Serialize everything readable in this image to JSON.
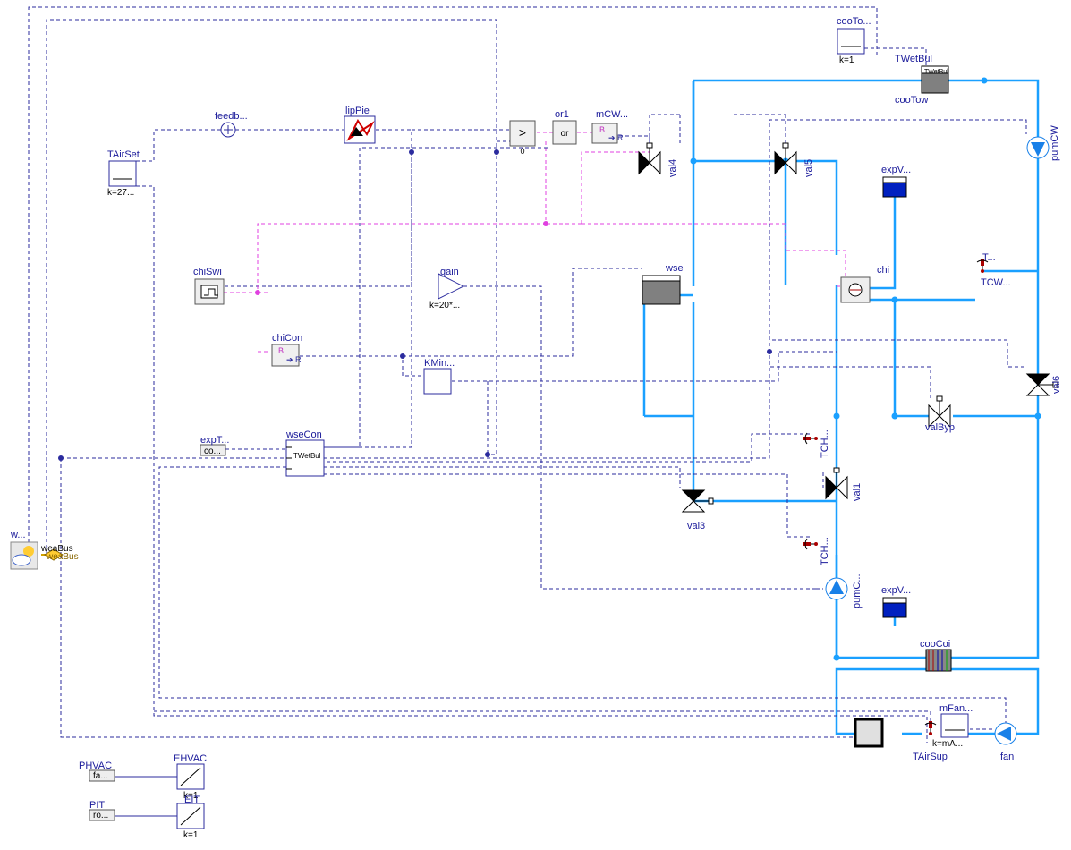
{
  "labels": {
    "cooTo": "cooTo...",
    "cooTo_k": "k=1",
    "TWetBul_top": "TWetBul",
    "cooTow": "cooTow",
    "pumCW": "pumCW",
    "feedb": "feedb...",
    "lipPie": "lipPie",
    "or1": "or1",
    "mCW": "mCW...",
    "TAirSet": "TAirSet",
    "TAirSet_k": "k=27...",
    "gt0": "0",
    "gt": ">",
    "or": "or",
    "B": "B",
    "R": "R",
    "val4": "val4",
    "val5": "val5",
    "expV": "expV...",
    "T": "T...",
    "TCW": "TCW...",
    "chi": "chi",
    "wse": "wse",
    "chiSwi": "chiSwi",
    "gain": "gain",
    "gain_k": "k=20*...",
    "chiCon": "chiCon",
    "KMin": "KMin...",
    "valByp": "valByp",
    "val6": "val6",
    "TCH1": "TCH...",
    "val1": "val1",
    "val3": "val3",
    "TCH2": "TCH...",
    "pumC": "pumC...",
    "expV2": "expV...",
    "expT": "expT...",
    "co": "co...",
    "wseCon": "wseCon",
    "TWetBul2": "TWetBul",
    "w": "w...",
    "weaBus": "weaBus",
    "weaBus2": "weaBus",
    "cooCoi": "cooCoi",
    "mFan": "mFan...",
    "mFan_k": "k=mA...",
    "TAirSup": "TAirSup",
    "fan": "fan",
    "PHVAC": "PHVAC",
    "fa": "fa...",
    "EHVAC": "EHVAC",
    "EHVAC_k": "k=1",
    "PIT": "PIT",
    "ro": "ro...",
    "EIT": "EIT",
    "EIT_k": "k=1"
  }
}
